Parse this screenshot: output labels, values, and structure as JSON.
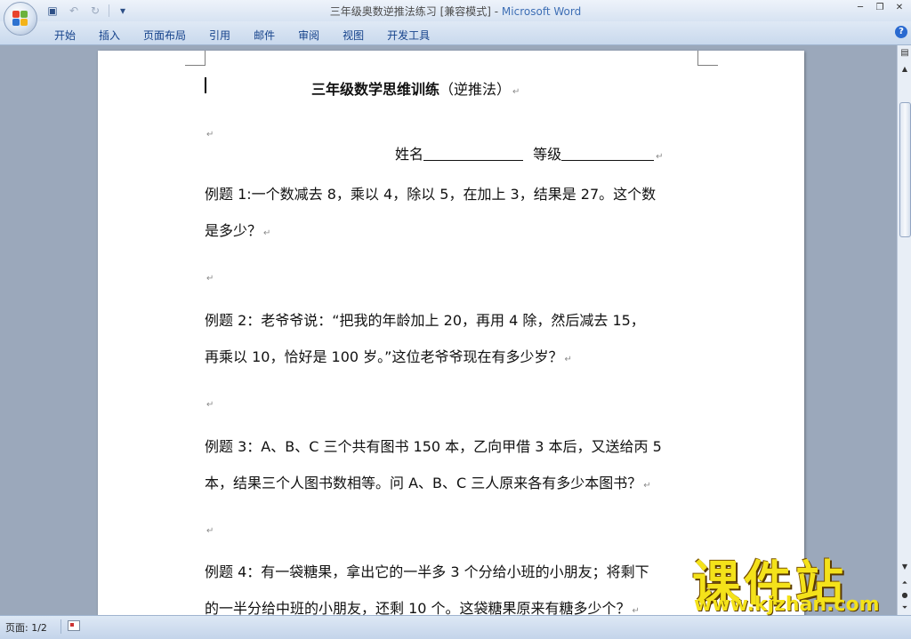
{
  "window": {
    "title_doc": "三年级奥数逆推法练习 [兼容模式] - ",
    "title_app": "Microsoft Word"
  },
  "quick_access": {
    "save_icon": "save-icon",
    "undo_icon": "undo-icon",
    "redo_icon": "redo-icon",
    "customize_icon": "dropdown-icon"
  },
  "ribbon": {
    "tabs": [
      "开始",
      "插入",
      "页面布局",
      "引用",
      "邮件",
      "审阅",
      "视图",
      "开发工具"
    ]
  },
  "document": {
    "title_bold": "三年级数学思维训练",
    "title_rest": "（逆推法）",
    "name_label": "姓名",
    "grade_label": "等级",
    "q1_line1": "例题 1:一个数减去 8，乘以 4，除以 5，在加上 3，结果是 27。这个数",
    "q1_line2": "是多少？",
    "q2_line1": "例题 2：老爷爷说：“把我的年龄加上 20，再用 4 除，然后减去 15，",
    "q2_line2": "再乘以 10，恰好是 100 岁。”这位老爷爷现在有多少岁？",
    "q3_line1": "例题 3：A、B、C 三个共有图书 150 本，乙向甲借 3 本后，又送给丙 5",
    "q3_line2": "本，结果三个人图书数相等。问 A、B、C 三人原来各有多少本图书？",
    "q4_line1": "例题 4：有一袋糖果，拿出它的一半多 3 个分给小班的小朋友；将剩下",
    "q4_line2": "的一半分给中班的小朋友，还剩 10 个。这袋糖果原来有糖多少个？",
    "paragraph_mark": "↵"
  },
  "statusbar": {
    "page": "页面: 1/2"
  },
  "watermark": {
    "main": "课件站",
    "url": "www.kjzhan.com"
  }
}
